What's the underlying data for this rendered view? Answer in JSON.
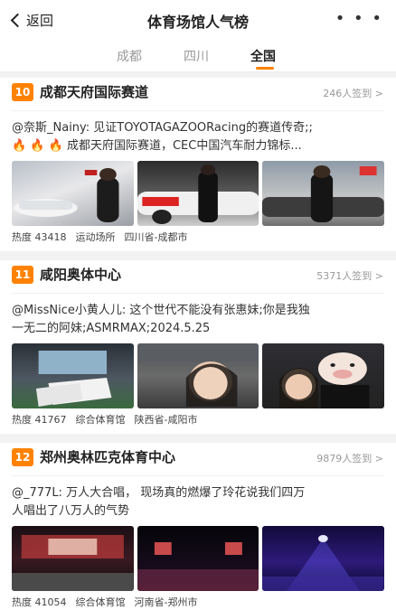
{
  "header": {
    "back_label": "返回",
    "title": "体育场馆人气榜",
    "more": "• • •"
  },
  "tabs": [
    {
      "label": "成都",
      "active": false
    },
    {
      "label": "四川",
      "active": false
    },
    {
      "label": "全国",
      "active": true
    }
  ],
  "accent_color": "#ff8200",
  "venues": [
    {
      "rank": "10",
      "name": "成都天府国际赛道",
      "checkins": "246人签到 >",
      "post_line1": "@奈斯_Nainy: 见证TOYOTAGAZOORacing的赛道传奇;;",
      "post_line2": "成都天府国际赛道，CEC中国汽车耐力锦标...",
      "heat": "热度 43418",
      "category": "运动场所",
      "location": "四川省-成都市"
    },
    {
      "rank": "11",
      "name": "咸阳奥体中心",
      "checkins": "5371人签到 >",
      "post_line1": "@MissNice小黄人儿: 这个世代不能没有张惠妹;你是我独",
      "post_line2": "一无二的阿妹;ASMRMAX;2024.5.25",
      "heat": "热度 41767",
      "category": "综合体育馆",
      "location": "陕西省-咸阳市"
    },
    {
      "rank": "12",
      "name": "郑州奥林匹克体育中心",
      "checkins": "9879人签到 >",
      "post_line1": "@_777L: 万人大合唱， 现场真的燃爆了玲花说我们四万",
      "post_line2": "人唱出了八万人的气势",
      "heat": "热度 41054",
      "category": "综合体育馆",
      "location": "河南省-郑州市"
    }
  ]
}
